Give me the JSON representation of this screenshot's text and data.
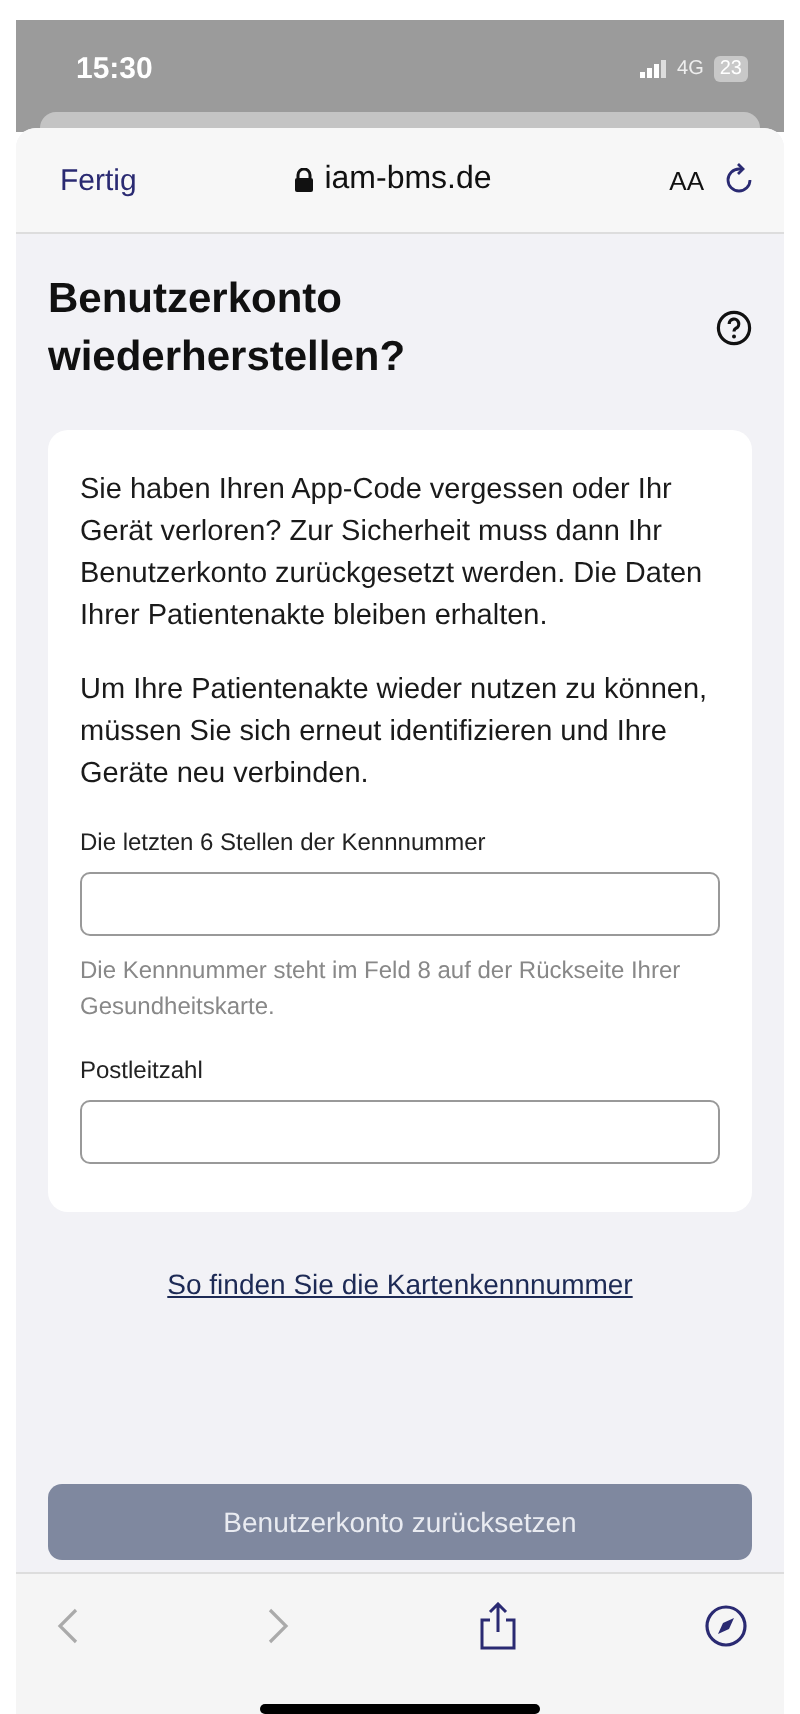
{
  "status_bar": {
    "time": "15:30",
    "network": "4G",
    "battery": "23"
  },
  "browser_bar": {
    "done": "Fertig",
    "url": "iam-bms.de",
    "text_size": "AA"
  },
  "page": {
    "title": "Benutzerkonto wiederherstellen?",
    "paragraphs": [
      "Sie haben Ihren App-Code vergessen oder Ihr Gerät verloren? Zur Sicherheit muss dann Ihr Benutzerkonto zurückgesetzt werden. Die Daten Ihrer Patientenakte bleiben erhalten.",
      "Um Ihre Patientenakte wieder nutzen zu können, müssen Sie sich erneut identifizieren und Ihre Geräte neu verbinden."
    ],
    "fields": [
      {
        "label": "Die letzten 6 Stellen der Kennnummer",
        "hint": "Die Kennnummer steht im Feld 8 auf der Rückseite Ihrer Gesundheitskarte."
      },
      {
        "label": "Postleitzahl"
      }
    ],
    "link": "So finden Sie die Kartenkennnummer",
    "submit": {
      "label": "Benutzerkonto zurücksetzen",
      "disabled": true
    }
  },
  "bottom_toolbar": {
    "back_disabled": true,
    "forward_disabled": true
  }
}
